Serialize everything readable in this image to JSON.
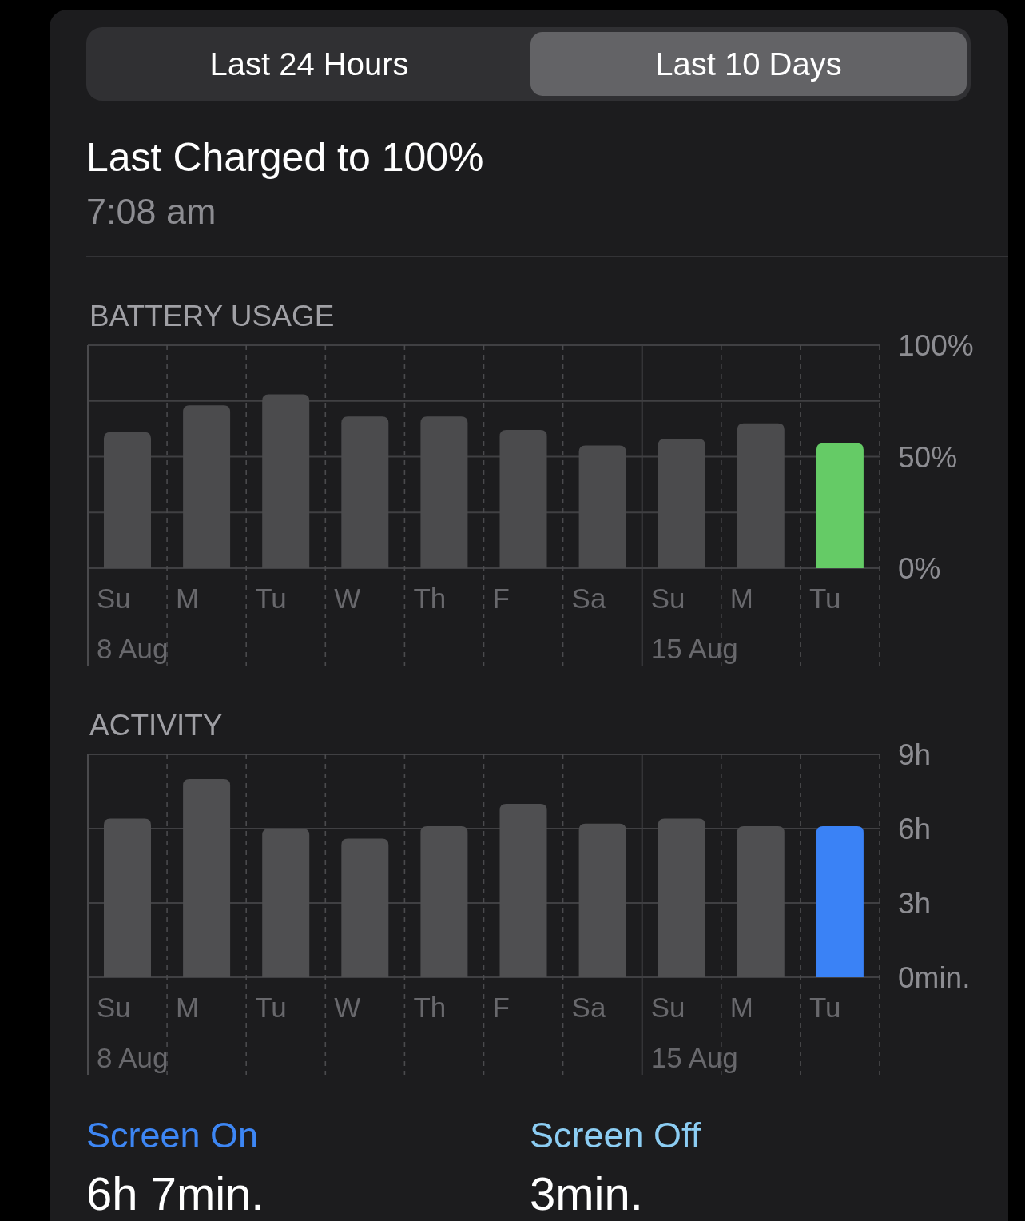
{
  "tabs": [
    {
      "label": "Last 24 Hours",
      "selected": false
    },
    {
      "label": "Last 10 Days",
      "selected": true
    }
  ],
  "last_charged": {
    "title": "Last Charged to 100%",
    "time": "7:08 am"
  },
  "battery_usage": {
    "chart_data": {
      "type": "bar",
      "title": "BATTERY USAGE",
      "categories": [
        "Su",
        "M",
        "Tu",
        "W",
        "Th",
        "F",
        "Sa",
        "Su",
        "M",
        "Tu"
      ],
      "stacked": true,
      "series": [
        {
          "color": "#4b4b4d",
          "values": [
            61,
            73,
            78,
            68,
            68,
            62,
            55,
            58,
            65,
            null
          ]
        },
        {
          "color": "#65cb66",
          "values": [
            null,
            null,
            null,
            null,
            null,
            null,
            null,
            null,
            null,
            56
          ]
        }
      ],
      "ylim": [
        0,
        100
      ],
      "yticks": [
        {
          "value": 100,
          "label": "100%"
        },
        {
          "value": 50,
          "label": "50%"
        },
        {
          "value": 0,
          "label": "0%"
        }
      ],
      "annotations": [
        "8 Aug",
        "15 Aug"
      ]
    }
  },
  "activity": {
    "chart_data": {
      "type": "bar",
      "title": "ACTIVITY",
      "categories": [
        "Su",
        "M",
        "Tu",
        "W",
        "Th",
        "F",
        "Sa",
        "Su",
        "M",
        "Tu"
      ],
      "stacked": true,
      "series": [
        {
          "color": "#4f4f51",
          "values": [
            6.4,
            8.0,
            6.0,
            5.6,
            6.1,
            7.0,
            6.2,
            6.4,
            6.1,
            null
          ]
        },
        {
          "color": "#3a82f6",
          "values": [
            null,
            null,
            null,
            null,
            null,
            null,
            null,
            null,
            null,
            6.1
          ]
        }
      ],
      "ylim": [
        0,
        9
      ],
      "yticks": [
        {
          "value": 9,
          "label": "9h"
        },
        {
          "value": 6,
          "label": "6h"
        },
        {
          "value": 3,
          "label": "3h"
        },
        {
          "value": 0,
          "label": "0min."
        }
      ],
      "annotations": [
        "8 Aug",
        "15 Aug"
      ]
    },
    "summary": [
      {
        "label": "Screen On",
        "value": "6h 7min.",
        "color": "#3d86f4"
      },
      {
        "label": "Screen Off",
        "value": "3min.",
        "color": "#8ccdf3"
      }
    ]
  }
}
